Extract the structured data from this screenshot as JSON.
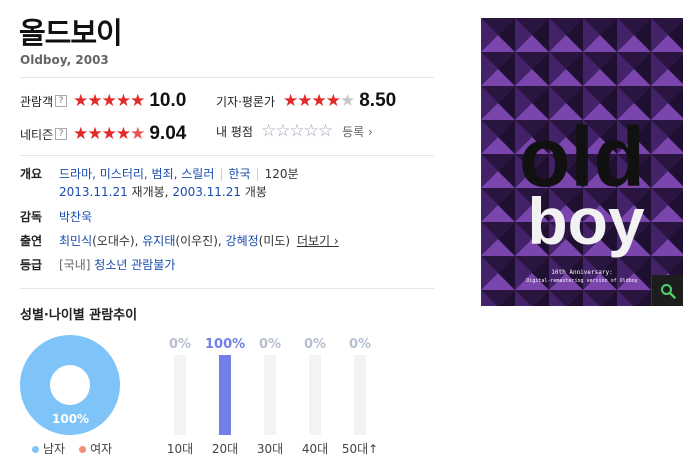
{
  "movie": {
    "title": "올드보이",
    "subtitle": "Oldboy, 2003"
  },
  "ratings": {
    "audience": {
      "label": "관람객",
      "help": "?",
      "score": "10.0",
      "stars": 5.0
    },
    "critic": {
      "label": "기자·평론가",
      "score": "8.50",
      "stars": 4.25
    },
    "netizen": {
      "label": "네티즌",
      "help": "?",
      "score": "9.04",
      "stars": 4.5
    },
    "mine": {
      "label": "내 평점",
      "register": "등록 ›",
      "stars": 0
    }
  },
  "info": {
    "overview_label": "개요",
    "genres": "드라마, 미스터리, 범죄, 스릴러",
    "country": "한국",
    "runtime": "120분",
    "rerelease_date": "2013.11.21",
    "rerelease_text": "재개봉,",
    "release_date": "2003.11.21",
    "release_text": "개봉",
    "director_label": "감독",
    "director": "박찬욱",
    "cast_label": "출연",
    "cast_1_name": "최민식",
    "cast_1_role": "(오대수),",
    "cast_2_name": "유지태",
    "cast_2_role": "(이우진),",
    "cast_3_name": "강혜정",
    "cast_3_role": "(미도)",
    "more": "더보기 ›",
    "grade_label": "등급",
    "grade_region": "[국내]",
    "grade": "청소년 관람불가"
  },
  "poster": {
    "text_top": "old",
    "text_bottom": "boy",
    "caption_line1": "10th Anniversary:",
    "caption_line2": "Digital-remastering version of Oldboy",
    "zoom_icon": "search-icon"
  },
  "stats": {
    "title": "성별·나이별 관람추이",
    "gender": {
      "male_pct": 100,
      "male_label": "100%",
      "male": "남자",
      "female": "여자",
      "male_color": "#7ec4f8",
      "female_color": "#f08b7a"
    },
    "ages": [
      {
        "label": "10대",
        "pct_text": "0%",
        "value": 0
      },
      {
        "label": "20대",
        "pct_text": "100%",
        "value": 100
      },
      {
        "label": "30대",
        "pct_text": "0%",
        "value": 0
      },
      {
        "label": "40대",
        "pct_text": "0%",
        "value": 0
      },
      {
        "label": "50대↑",
        "pct_text": "0%",
        "value": 0
      }
    ]
  }
}
